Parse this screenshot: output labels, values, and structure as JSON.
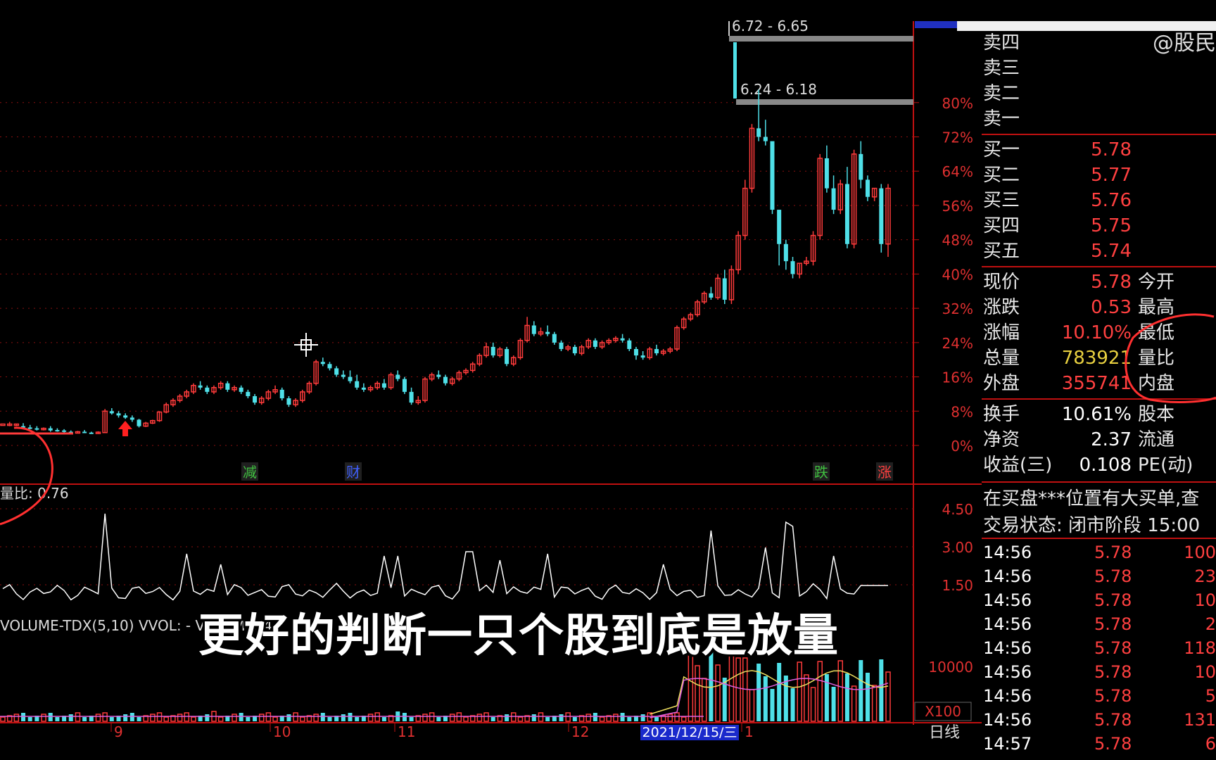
{
  "chart_data": {
    "type": "candlestick",
    "title": "",
    "price_axis": {
      "ticks": [
        "0%",
        "8%",
        "16%",
        "24%",
        "32%",
        "40%",
        "48%",
        "56%",
        "64%",
        "72%",
        "80%"
      ],
      "range_pct": [
        0,
        88
      ]
    },
    "volume_ratio_axis": {
      "ticks": [
        "1.50",
        "3.00",
        "4.50"
      ]
    },
    "volume_axis": {
      "ticks": [
        "10000"
      ],
      "unit": "X100"
    },
    "x_labels": [
      "9",
      "10",
      "11",
      "12",
      "1"
    ],
    "date_marker": "2021/12/15/三",
    "period": "日线",
    "candles_pct": [
      [
        5,
        5,
        5,
        5
      ],
      [
        5,
        5.5,
        5,
        4.5
      ],
      [
        5,
        5,
        5,
        4.5
      ],
      [
        4.5,
        5.2,
        4.2,
        4
      ],
      [
        4.2,
        4.8,
        4,
        3.8
      ],
      [
        4,
        4.5,
        3.8,
        3.5
      ],
      [
        3.8,
        4.2,
        4,
        3.5
      ],
      [
        4,
        4.5,
        3.5,
        3.2
      ],
      [
        3.6,
        4,
        3.5,
        3.2
      ],
      [
        3.5,
        3.8,
        3.2,
        3
      ],
      [
        3.2,
        3.5,
        3,
        2.8
      ],
      [
        3,
        3.4,
        3.2,
        2.8
      ],
      [
        3.2,
        3.6,
        3,
        2.9
      ],
      [
        3,
        3.2,
        2.9,
        2.7
      ],
      [
        2.9,
        3.3,
        3.1,
        2.8
      ],
      [
        3,
        8.5,
        8,
        3
      ],
      [
        8,
        8.7,
        7.5,
        7.2
      ],
      [
        7.5,
        8,
        7,
        6.5
      ],
      [
        7,
        7.5,
        6.5,
        6.2
      ],
      [
        6.5,
        7,
        6,
        5.5
      ],
      [
        6,
        6.2,
        4.5,
        4.2
      ],
      [
        4.5,
        5.5,
        5.2,
        4.3
      ],
      [
        5.2,
        6,
        5.8,
        5
      ],
      [
        5.8,
        8,
        7.8,
        5.5
      ],
      [
        7.8,
        10,
        9.5,
        7.5
      ],
      [
        9.5,
        11,
        10.5,
        9
      ],
      [
        10.5,
        12,
        11.5,
        10
      ],
      [
        11.5,
        13,
        12.5,
        11
      ],
      [
        12.5,
        14.5,
        14,
        12
      ],
      [
        14,
        15,
        13.5,
        13
      ],
      [
        13.5,
        14,
        12.5,
        12
      ],
      [
        12.5,
        14,
        13.5,
        12
      ],
      [
        13.5,
        15,
        14.5,
        13
      ],
      [
        14.5,
        15,
        13,
        12.5
      ],
      [
        13,
        14,
        13.5,
        12.5
      ],
      [
        13.5,
        14,
        12.5,
        12
      ],
      [
        12.5,
        13,
        11.5,
        11
      ],
      [
        11.5,
        12,
        10,
        9.5
      ],
      [
        10,
        11.5,
        11,
        9.5
      ],
      [
        11,
        13,
        12.5,
        10.5
      ],
      [
        12.5,
        14,
        13,
        12
      ],
      [
        13,
        13.5,
        11,
        10.5
      ],
      [
        11,
        11.5,
        9.5,
        9
      ],
      [
        9.5,
        11,
        10.5,
        9
      ],
      [
        10.5,
        13,
        12.5,
        10
      ],
      [
        12.5,
        15,
        14.5,
        12
      ],
      [
        14.5,
        20,
        19.5,
        14
      ],
      [
        19.5,
        20.5,
        19,
        18.5
      ],
      [
        19,
        19.5,
        18,
        17.5
      ],
      [
        18,
        18.5,
        16.5,
        16
      ],
      [
        16.5,
        17.5,
        16,
        15.5
      ],
      [
        16,
        17.5,
        15,
        14.5
      ],
      [
        15,
        16.5,
        13.5,
        13
      ],
      [
        13.5,
        14.5,
        13,
        12.5
      ],
      [
        13,
        14,
        13.5,
        12.5
      ],
      [
        13.5,
        15,
        14.5,
        13
      ],
      [
        14.5,
        15.5,
        13.5,
        13
      ],
      [
        13.5,
        17,
        16.5,
        13
      ],
      [
        16.5,
        17.5,
        15.5,
        15
      ],
      [
        15.5,
        16,
        12.5,
        12
      ],
      [
        12.5,
        13.5,
        10,
        9.5
      ],
      [
        10,
        11.5,
        10.5,
        9.5
      ],
      [
        10.5,
        16,
        15.5,
        10
      ],
      [
        15.5,
        17,
        16.5,
        15
      ],
      [
        16.5,
        17.5,
        16,
        15.5
      ],
      [
        16,
        16.5,
        14.5,
        14
      ],
      [
        14.5,
        16,
        15.5,
        14
      ],
      [
        15.5,
        17.5,
        17,
        15
      ],
      [
        17,
        18,
        17.5,
        16.5
      ],
      [
        17.5,
        19.5,
        19,
        17
      ],
      [
        19,
        21.5,
        21,
        18.5
      ],
      [
        21,
        24,
        23,
        20.5
      ],
      [
        23,
        24,
        21,
        20.5
      ],
      [
        21,
        23,
        22.5,
        20.5
      ],
      [
        22.5,
        23,
        19,
        18.5
      ],
      [
        19,
        21,
        20.5,
        18.5
      ],
      [
        20.5,
        25,
        24.5,
        20
      ],
      [
        24.5,
        30,
        28,
        24
      ],
      [
        28,
        29,
        26,
        25.5
      ],
      [
        26,
        27.5,
        26.5,
        25.5
      ],
      [
        26.5,
        28,
        26,
        25.5
      ],
      [
        26,
        26.5,
        24,
        23.5
      ],
      [
        24,
        24.5,
        22.5,
        22
      ],
      [
        22.5,
        23.5,
        23,
        22
      ],
      [
        23,
        23.5,
        21.5,
        21
      ],
      [
        21.5,
        23.5,
        23,
        21
      ],
      [
        23,
        25,
        24.5,
        22.5
      ],
      [
        24.5,
        25,
        23,
        22.5
      ],
      [
        23,
        24.5,
        24,
        22.5
      ],
      [
        24,
        25,
        24.5,
        23.5
      ],
      [
        24.5,
        25.5,
        25,
        24
      ],
      [
        25,
        26,
        24.5,
        24
      ],
      [
        24.5,
        25,
        22.5,
        22
      ],
      [
        22.5,
        23,
        21,
        20
      ],
      [
        21,
        22,
        20.5,
        20
      ],
      [
        20.5,
        23,
        22.5,
        20
      ],
      [
        22.5,
        23.5,
        21.5,
        21
      ],
      [
        21.5,
        22.5,
        22,
        21
      ],
      [
        22,
        23,
        22.5,
        21.5
      ],
      [
        22.5,
        28,
        27.5,
        22
      ],
      [
        27.5,
        30,
        29.5,
        27
      ],
      [
        29.5,
        31,
        30.5,
        29
      ],
      [
        30.5,
        34,
        33.5,
        30
      ],
      [
        33.5,
        36,
        35.5,
        33
      ],
      [
        35.5,
        37,
        34.5,
        34
      ],
      [
        34.5,
        40,
        39,
        34
      ],
      [
        39,
        41,
        34,
        33
      ],
      [
        34,
        42,
        41,
        33
      ],
      [
        41,
        50,
        49,
        40
      ],
      [
        49,
        62,
        60,
        48
      ],
      [
        60,
        75,
        74,
        59
      ],
      [
        74,
        83,
        72,
        71
      ],
      [
        72,
        76,
        71,
        70
      ],
      [
        71,
        56,
        55,
        54
      ],
      [
        55,
        49,
        47,
        42
      ],
      [
        47,
        48,
        43,
        41
      ],
      [
        43,
        44,
        40,
        39
      ],
      [
        40,
        42.5,
        42.5,
        39
      ],
      [
        42.5,
        44,
        43,
        42
      ],
      [
        43,
        50,
        49,
        42
      ],
      [
        49,
        68,
        67,
        48
      ],
      [
        67,
        70,
        60,
        59
      ],
      [
        60,
        63,
        55,
        54
      ],
      [
        55,
        62,
        61,
        54
      ],
      [
        61,
        65,
        47,
        46
      ],
      [
        47,
        69,
        68,
        46
      ],
      [
        68,
        71,
        62,
        60
      ],
      [
        62,
        63,
        58,
        57
      ],
      [
        58,
        60,
        60,
        57
      ],
      [
        60,
        61,
        47,
        45
      ],
      [
        47,
        61,
        60,
        44
      ]
    ],
    "level_labels": [
      "6.72 - 6.65",
      "6.24 - 6.18"
    ],
    "event_markers": [
      "减",
      "财",
      "跌",
      "涨"
    ],
    "volume_ratio_label": "量比: 0.76",
    "volume_indicator_label": "VOLUME-TDX(5,10) VVOL: -  VOLUME: 4"
  },
  "quote_panel": {
    "watermark": "@股民",
    "sell": [
      {
        "label": "卖四"
      },
      {
        "label": "卖三"
      },
      {
        "label": "卖二"
      },
      {
        "label": "卖一"
      }
    ],
    "buy": [
      {
        "label": "买一",
        "price": "5.78"
      },
      {
        "label": "买二",
        "price": "5.77"
      },
      {
        "label": "买三",
        "price": "5.76"
      },
      {
        "label": "买四",
        "price": "5.75"
      },
      {
        "label": "买五",
        "price": "5.74"
      }
    ],
    "stats": [
      {
        "label": "现价",
        "value": "5.78",
        "label2": "今开",
        "color": "red"
      },
      {
        "label": "涨跌",
        "value": "0.53",
        "label2": "最高",
        "color": "red"
      },
      {
        "label": "涨幅",
        "value": "10.10%",
        "label2": "最低",
        "color": "red"
      },
      {
        "label": "总量",
        "value": "783921",
        "label2": "量比",
        "color": "yellow"
      },
      {
        "label": "外盘",
        "value": "355741",
        "label2": "内盘",
        "color": "red"
      }
    ],
    "fundamentals": [
      {
        "label": "换手",
        "value": "10.61%",
        "label2": "股本"
      },
      {
        "label": "净资",
        "value": "2.37",
        "label2": "流通"
      },
      {
        "label": "收益(三)",
        "value": "0.108",
        "label2": "PE(动)"
      }
    ],
    "notice": "在买盘***位置有大买单,查",
    "trade_status": "交易状态: 闭市阶段 15:00",
    "ticks": [
      {
        "time": "14:56",
        "price": "5.78",
        "vol": "100"
      },
      {
        "time": "14:56",
        "price": "5.78",
        "vol": "23"
      },
      {
        "time": "14:56",
        "price": "5.78",
        "vol": "10"
      },
      {
        "time": "14:56",
        "price": "5.78",
        "vol": "2"
      },
      {
        "time": "14:56",
        "price": "5.78",
        "vol": "118"
      },
      {
        "time": "14:56",
        "price": "5.78",
        "vol": "10"
      },
      {
        "time": "14:56",
        "price": "5.78",
        "vol": "5"
      },
      {
        "time": "14:56",
        "price": "5.78",
        "vol": "131"
      },
      {
        "time": "14:57",
        "price": "5.78",
        "vol": "6"
      }
    ]
  },
  "subtitle": "更好的判断一只个股到底是放量"
}
